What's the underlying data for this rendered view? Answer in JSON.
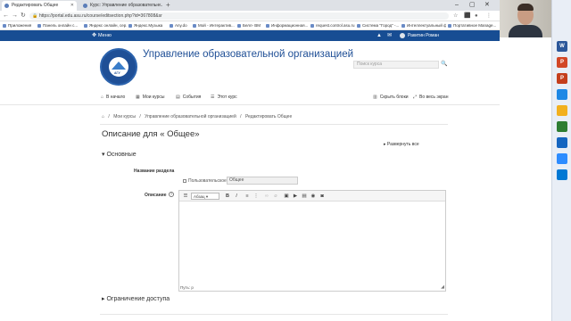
{
  "browser": {
    "tabs": [
      {
        "title": "Редактировать Общее"
      },
      {
        "title": "Курс: Управление образовательн..."
      }
    ],
    "address": "https://portal.edu.asu.ru/course/editsection.php?id=367808&sr",
    "bookmarks": [
      "Приложения",
      "Панель онлайн с...",
      "Яндекс онлайн, сер...",
      "Яндекс.Музыка",
      "Any.do",
      "Мой - Интерактив...",
      "Белл- ВМ",
      "Информационная...",
      "request.control.asu.ru",
      "Система \"Город\" -...",
      "Интеллектуальный ф...",
      "Портативное Manage..."
    ]
  },
  "navbar": {
    "menu_label": "Меню",
    "user_name": "Ракитин Роман"
  },
  "header": {
    "site_title": "Управление образовательной организацией",
    "search_placeholder": "Поиск курса",
    "logo_text": "АГУ"
  },
  "subnav": {
    "home": "В начало",
    "my_courses": "Мои курсы",
    "events": "События",
    "this_course": "Этот курс",
    "hide_blocks": "Скрыть блоки",
    "fullscreen": "Во весь экран"
  },
  "breadcrumb": {
    "items": [
      "Мои курсы",
      "Управление образовательной организацией",
      "Редактировать Общее"
    ]
  },
  "page": {
    "heading": "Описание для « Общее»",
    "expand_all": "Развернуть все",
    "section_general": "Основные",
    "label_section_name": "Название раздела",
    "custom_checkbox": "Пользовательское",
    "section_name_value": "Общее",
    "label_description": "Описание",
    "editor_para_select": "Абзац",
    "editor_status": "Путь: p",
    "section_access": "Ограничение доступа"
  },
  "colors": {
    "navbar": "#174d93",
    "title": "#1f4f96"
  }
}
